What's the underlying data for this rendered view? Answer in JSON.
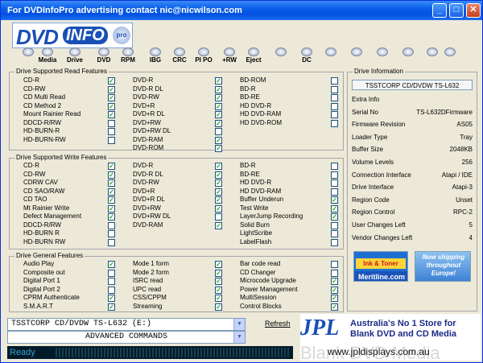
{
  "window": {
    "title": "For DVDInfoPro advertising contact nic@nicwilson.com"
  },
  "logo": {
    "dvd": "DVD",
    "info": "INFO",
    "pro": "pro"
  },
  "toolbar": [
    {
      "label": "",
      "icon": "monitor-icon"
    },
    {
      "label": "Media",
      "icon": "media-icon"
    },
    {
      "label": "Drive",
      "icon": "drive-icon"
    },
    {
      "label": "DVD",
      "icon": "dvd-icon"
    },
    {
      "label": "RPM",
      "icon": "rpm-icon"
    },
    {
      "label": "IBG",
      "icon": "ibg-icon"
    },
    {
      "label": "CRC",
      "icon": "crc-icon"
    },
    {
      "label": "PI PO",
      "icon": "pipo-icon"
    },
    {
      "label": "+RW",
      "icon": "rw-icon"
    },
    {
      "label": "Eject",
      "icon": "eject-icon"
    },
    {
      "label": "",
      "icon": "disc-burn-icon"
    },
    {
      "label": "DC",
      "icon": "dc-icon"
    },
    {
      "label": "",
      "icon": "clipboard-icon"
    },
    {
      "label": "",
      "icon": "camera-icon"
    },
    {
      "label": "",
      "icon": "edit-icon"
    },
    {
      "label": "",
      "icon": "info-icon"
    },
    {
      "label": "",
      "icon": "help-icon"
    },
    {
      "label": "",
      "icon": "money-icon"
    }
  ],
  "read_features": {
    "title": "Drive Supported Read Features",
    "columns": [
      [
        {
          "label": "CD-R",
          "checked": true
        },
        {
          "label": "CD-RW",
          "checked": true
        },
        {
          "label": "CD Multi Read",
          "checked": true
        },
        {
          "label": "CD Method 2",
          "checked": true
        },
        {
          "label": "Mount Rainier Read",
          "checked": true
        },
        {
          "label": "DDCD-R/RW",
          "checked": false
        },
        {
          "label": "HD-BURN-R",
          "checked": false
        },
        {
          "label": "HD-BURN-RW",
          "checked": false
        }
      ],
      [
        {
          "label": "DVD-R",
          "checked": true
        },
        {
          "label": "DVD-R DL",
          "checked": true
        },
        {
          "label": "DVD-RW",
          "checked": true
        },
        {
          "label": "DVD+R",
          "checked": true
        },
        {
          "label": "DVD+R DL",
          "checked": true
        },
        {
          "label": "DVD+RW",
          "checked": true
        },
        {
          "label": "DVD+RW DL",
          "checked": false
        },
        {
          "label": "DVD-RAM",
          "checked": true
        },
        {
          "label": "DVD-ROM",
          "checked": true
        }
      ],
      [
        {
          "label": "BD-ROM",
          "checked": false
        },
        {
          "label": "BD-R",
          "checked": false
        },
        {
          "label": "BD-RE",
          "checked": false
        },
        {
          "label": "HD DVD-R",
          "checked": false
        },
        {
          "label": "HD DVD-RAM",
          "checked": false
        },
        {
          "label": "HD DVD-ROM",
          "checked": false
        }
      ]
    ]
  },
  "write_features": {
    "title": "Drive Supported Write Features",
    "columns": [
      [
        {
          "label": "CD-R",
          "checked": true
        },
        {
          "label": "CD-RW",
          "checked": true
        },
        {
          "label": "CDRW CAV",
          "checked": true
        },
        {
          "label": "CD SAO/RAW",
          "checked": true
        },
        {
          "label": "CD TAO",
          "checked": true
        },
        {
          "label": "Mt Rainier Write",
          "checked": true
        },
        {
          "label": "Defect Management",
          "checked": true
        },
        {
          "label": "DDCD-R/RW",
          "checked": false
        },
        {
          "label": "HD-BURN R",
          "checked": false
        },
        {
          "label": "HD-BURN RW",
          "checked": false
        }
      ],
      [
        {
          "label": "DVD-R",
          "checked": true
        },
        {
          "label": "DVD-R DL",
          "checked": true
        },
        {
          "label": "DVD-RW",
          "checked": true
        },
        {
          "label": "DVD+R",
          "checked": true
        },
        {
          "label": "DVD+R DL",
          "checked": true
        },
        {
          "label": "DVD+RW",
          "checked": true
        },
        {
          "label": "DVD+RW DL",
          "checked": false
        },
        {
          "label": "DVD-RAM",
          "checked": true
        }
      ],
      [
        {
          "label": "BD-R",
          "checked": false
        },
        {
          "label": "BD-RE",
          "checked": false
        },
        {
          "label": "HD DVD-R",
          "checked": false
        },
        {
          "label": "HD DVD-RAM",
          "checked": false
        },
        {
          "label": "Buffer Underun",
          "checked": true
        },
        {
          "label": "Test Write",
          "checked": true
        },
        {
          "label": "LayerJump Recording",
          "checked": true
        },
        {
          "label": "Solid Burn",
          "checked": false
        },
        {
          "label": "LightScribe",
          "checked": false
        },
        {
          "label": "LabelFlash",
          "checked": false
        }
      ]
    ]
  },
  "general_features": {
    "title": "Drive General Features",
    "columns": [
      [
        {
          "label": "Audio Play",
          "checked": true
        },
        {
          "label": "Composite out",
          "checked": false
        },
        {
          "label": "Digital Port 1",
          "checked": false
        },
        {
          "label": "Digital Port 2",
          "checked": false
        },
        {
          "label": "CPRM Authenticate",
          "checked": true
        },
        {
          "label": "S.M.A.R.T",
          "checked": true
        }
      ],
      [
        {
          "label": "Mode 1 form",
          "checked": true
        },
        {
          "label": "Mode 2 form",
          "checked": true
        },
        {
          "label": "ISRC read",
          "checked": true
        },
        {
          "label": "UPC read",
          "checked": true
        },
        {
          "label": "CSS/CPPM",
          "checked": true
        },
        {
          "label": "Streaming",
          "checked": true
        }
      ],
      [
        {
          "label": "Bar code read",
          "checked": false
        },
        {
          "label": "CD Changer",
          "checked": false
        },
        {
          "label": "Microcode Upgrade",
          "checked": true
        },
        {
          "label": "Power Management",
          "checked": true
        },
        {
          "label": "MultiSession",
          "checked": true
        },
        {
          "label": "Control Blocks",
          "checked": true
        }
      ]
    ]
  },
  "drive_info": {
    "title": "Drive Information",
    "model": "TSSTCORP CD/DVDW TS-L632",
    "rows": [
      {
        "label": "Extra Info",
        "value": ""
      },
      {
        "label": "Serial No",
        "value": "TS-L632DFirmware"
      },
      {
        "label": "Firmware Revision",
        "value": "AS05"
      },
      {
        "label": "Loader Type",
        "value": "Tray"
      },
      {
        "label": "Buffer Size",
        "value": "2048KB"
      },
      {
        "label": "Volume Levels",
        "value": "256"
      },
      {
        "label": "Connection Interface",
        "value": "Atapi / IDE"
      },
      {
        "label": "Drive Interface",
        "value": "Atapi-3"
      },
      {
        "label": "Region Code",
        "value": "Unset"
      },
      {
        "label": "Region Control",
        "value": "RPC-2"
      },
      {
        "label": "User Changes Left",
        "value": "5"
      },
      {
        "label": "Vendor Changes Left",
        "value": "4"
      }
    ]
  },
  "ads": {
    "left_top": "Ink & Toner",
    "left_bottom": "Meritline.com",
    "right": "Now shipping throughout Europe!",
    "jpl_logo": "JPL",
    "jpl_line1": "Australia's No 1 Store for",
    "jpl_line2": "Blank DVD and CD Media",
    "jpl_url": "www.jpldisplays.com.au",
    "jpl_watermark": "Blank DVD Media"
  },
  "drive_select": {
    "value": "TSSTCORP CD/DVDW TS-L632 (E:)"
  },
  "command_select": {
    "value": "ADVANCED COMMANDS"
  },
  "refresh_label": "Refresh",
  "status_text": "Ready"
}
